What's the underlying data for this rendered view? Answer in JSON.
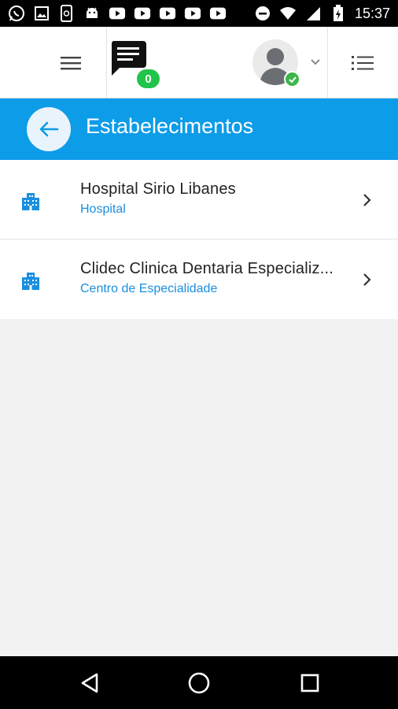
{
  "status_bar": {
    "time": "15:37",
    "left_icons": [
      "whatsapp-icon",
      "image-icon",
      "phone-sync-icon",
      "android-icon",
      "youtube-icon",
      "youtube-icon",
      "youtube-icon",
      "youtube-icon",
      "youtube-icon"
    ],
    "right_icons": [
      "do-not-disturb-icon",
      "wifi-icon",
      "signal-icon",
      "battery-charging-icon"
    ]
  },
  "header": {
    "chat_badge_count": "0"
  },
  "title_bar": {
    "title": "Estabelecimentos"
  },
  "establishments": [
    {
      "name": "Hospital Sirio Libanes",
      "type": "Hospital"
    },
    {
      "name": "Clidec Clinica Dentaria Especializ...",
      "type": "Centro de Especialidade"
    }
  ],
  "colors": {
    "primary": "#0d9ce8",
    "accent_text": "#1a8fe0",
    "badge_green": "#21c44a",
    "check_green": "#3cb54a"
  }
}
